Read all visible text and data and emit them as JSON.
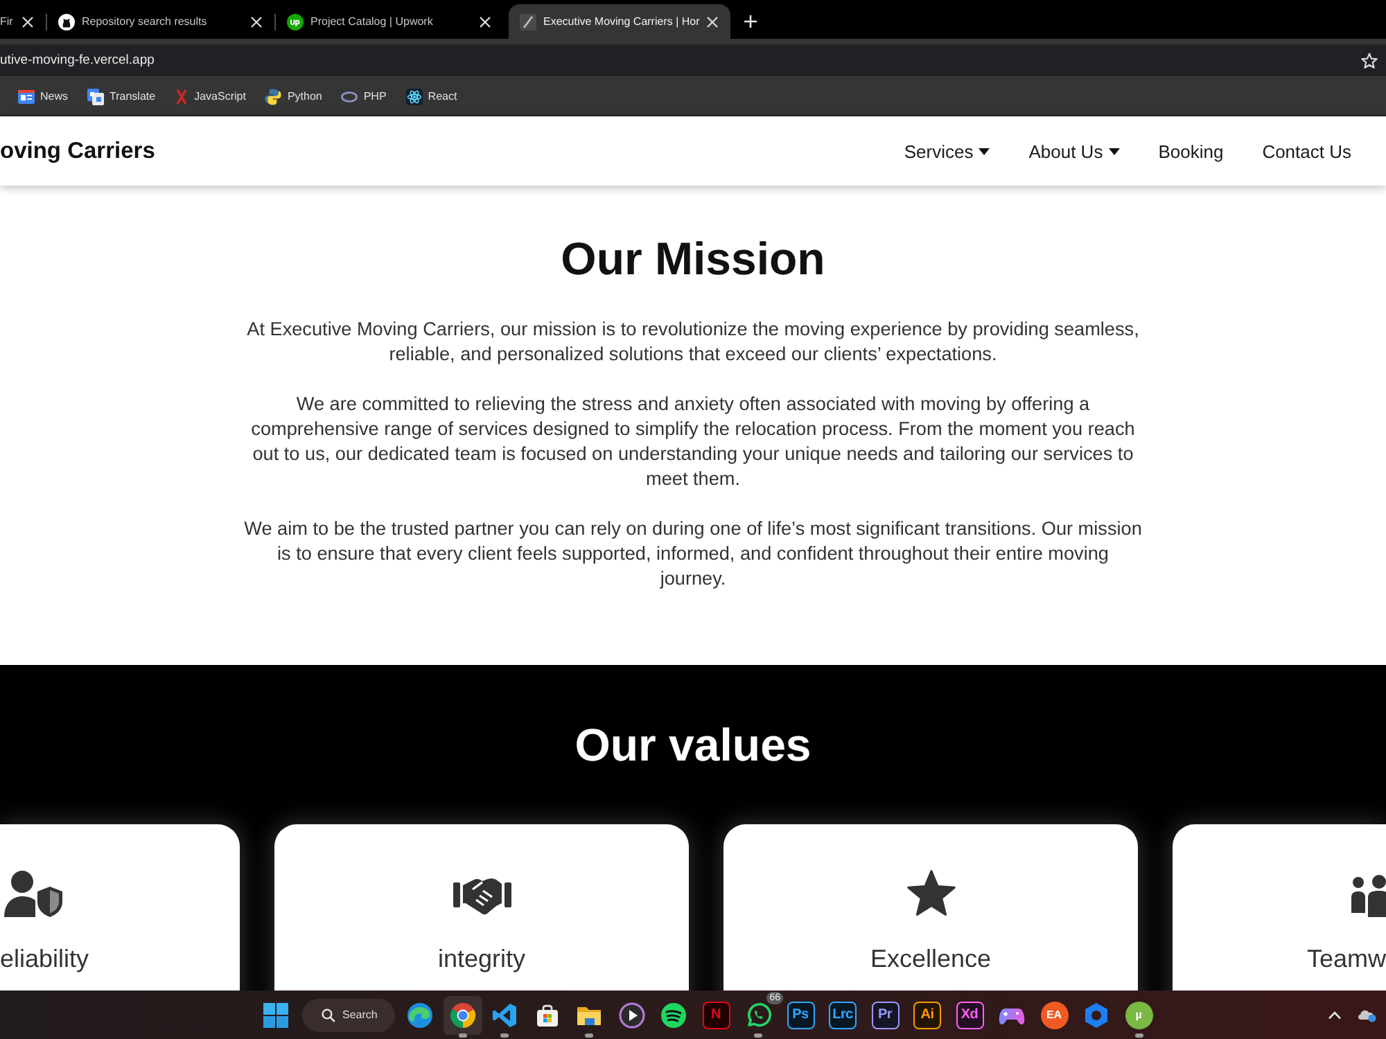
{
  "browser": {
    "tabs": [
      {
        "title": "Fir",
        "kind": "none",
        "selected": false
      },
      {
        "title": "Repository search results",
        "kind": "cat",
        "selected": false
      },
      {
        "title": "Project Catalog | Upwork",
        "kind": "badge",
        "selected": false
      },
      {
        "title": "Executive Moving Carriers | Hor",
        "kind": "monogram",
        "selected": true
      }
    ],
    "address": "utive-moving-fe.vercel.app",
    "bookmarks": [
      {
        "label": "News",
        "kind": "news"
      },
      {
        "label": "Translate",
        "kind": "translate"
      },
      {
        "label": "JavaScript",
        "kind": "cross"
      },
      {
        "label": "Python",
        "kind": "snake"
      },
      {
        "label": "PHP",
        "kind": "oval"
      },
      {
        "label": "React",
        "kind": "atom"
      }
    ]
  },
  "navbar": {
    "brand": "oving Carriers",
    "items": [
      {
        "label": "Services",
        "dropdown": true
      },
      {
        "label": "About Us",
        "dropdown": true
      },
      {
        "label": "Booking",
        "dropdown": false
      },
      {
        "label": "Contact Us",
        "dropdown": false
      }
    ]
  },
  "mission": {
    "title": "Our Mission",
    "paragraphs": [
      "At Executive Moving Carriers, our mission is to revolutionize the moving experience by providing seamless, reliable, and personalized solutions that exceed our clients’ expectations.",
      "We are committed to relieving the stress and anxiety often associated with moving by offering a comprehensive range of services designed to simplify the relocation process. From the moment you reach out to us, our dedicated team is focused on understanding your unique needs and tailoring our services to meet them.",
      "We aim to be the trusted partner you can rely on during one of life’s most significant transitions. Our mission is to ensure that every client feels supported, informed, and confident throughout their entire moving journey."
    ]
  },
  "values": {
    "title": "Our values",
    "cards": [
      {
        "label": "eliability",
        "kind": "person-shield",
        "cut_left": true,
        "cut_right": false
      },
      {
        "label": "integrity",
        "kind": "handshake",
        "cut_left": false,
        "cut_right": false
      },
      {
        "label": "Excellence",
        "kind": "star",
        "cut_left": false,
        "cut_right": false
      },
      {
        "label": "Teamw",
        "kind": "group",
        "cut_left": false,
        "cut_right": true
      }
    ]
  },
  "taskbar": {
    "search": "Search",
    "apps": [
      {
        "kind": "swirl",
        "selected": false,
        "running": false
      },
      {
        "kind": "segments",
        "selected": true,
        "running": true
      },
      {
        "kind": "ribbon",
        "selected": false,
        "running": true
      },
      {
        "kind": "bag",
        "selected": false,
        "running": false
      },
      {
        "kind": "folder",
        "selected": false,
        "running": true
      },
      {
        "kind": "play",
        "selected": false,
        "running": false
      },
      {
        "kind": "waves",
        "selected": false,
        "running": false
      },
      {
        "kind": "tile",
        "label": "N",
        "color": "#e50914",
        "selected": false,
        "running": false
      },
      {
        "kind": "chat",
        "badge": "66",
        "selected": false,
        "running": true
      },
      {
        "kind": "tile",
        "label": "Ps",
        "color": "#31a8ff",
        "selected": false,
        "running": false
      },
      {
        "kind": "tile",
        "label": "Lrc",
        "color": "#31a8ff",
        "selected": false,
        "running": false
      },
      {
        "kind": "tile",
        "label": "Pr",
        "color": "#9999ff",
        "selected": false,
        "running": false
      },
      {
        "kind": "tile",
        "label": "Ai",
        "color": "#ff9a00",
        "selected": false,
        "running": false
      },
      {
        "kind": "tile",
        "label": "Xd",
        "color": "#ff61f6",
        "selected": false,
        "running": false
      },
      {
        "kind": "gamepad",
        "selected": false,
        "running": false
      },
      {
        "kind": "round",
        "label": "EA",
        "color": "#f05a22",
        "selected": false,
        "running": false
      },
      {
        "kind": "hexagon",
        "selected": false,
        "running": false
      },
      {
        "kind": "round",
        "label": "µ",
        "color": "#78b843",
        "selected": false,
        "running": true
      }
    ]
  }
}
